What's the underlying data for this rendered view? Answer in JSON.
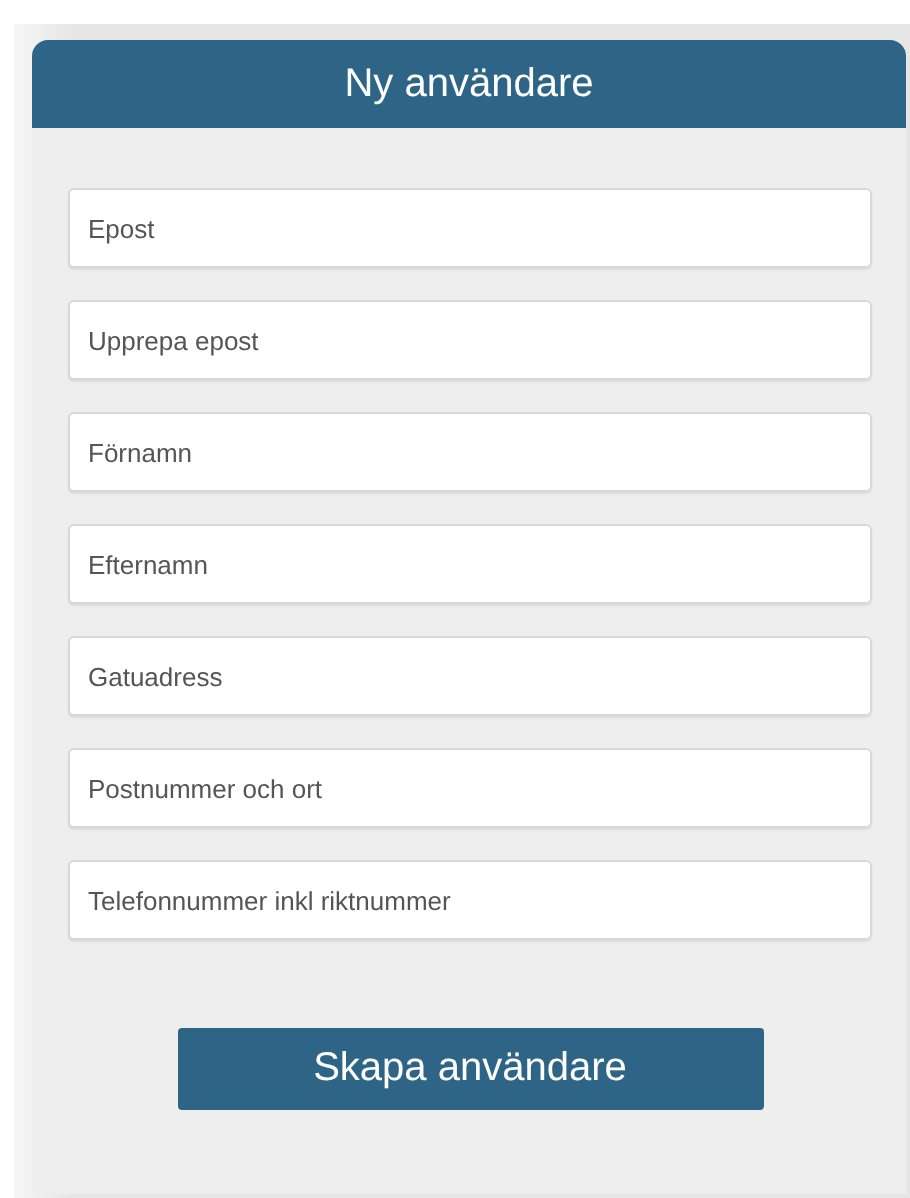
{
  "title": "Ny användare",
  "fields": [
    {
      "placeholder": "Epost"
    },
    {
      "placeholder": "Upprepa epost"
    },
    {
      "placeholder": "Förnamn"
    },
    {
      "placeholder": "Efternamn"
    },
    {
      "placeholder": "Gatuadress"
    },
    {
      "placeholder": "Postnummer och ort"
    },
    {
      "placeholder": "Telefonnummer inkl riktnummer"
    }
  ],
  "button": "Skapa användare"
}
